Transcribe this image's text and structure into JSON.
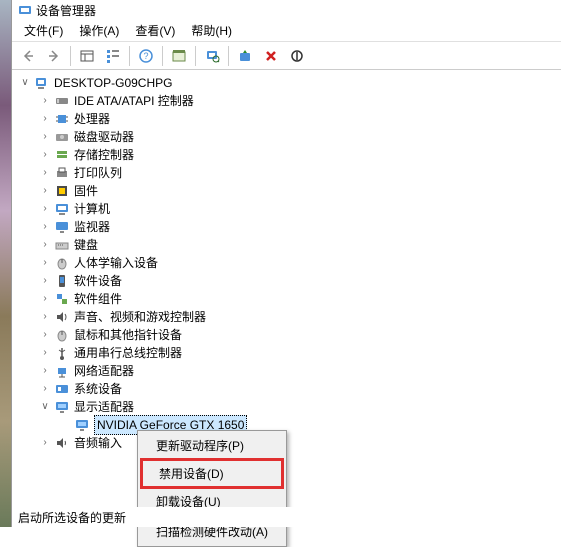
{
  "title": "设备管理器",
  "menu": {
    "file": "文件(F)",
    "action": "操作(A)",
    "view": "查看(V)",
    "help": "帮助(H)"
  },
  "root": "DESKTOP-G09CHPG",
  "categories": [
    {
      "label": "IDE ATA/ATAPI 控制器",
      "icon": "ide"
    },
    {
      "label": "处理器",
      "icon": "cpu"
    },
    {
      "label": "磁盘驱动器",
      "icon": "disk"
    },
    {
      "label": "存储控制器",
      "icon": "storage"
    },
    {
      "label": "打印队列",
      "icon": "printer"
    },
    {
      "label": "固件",
      "icon": "firmware"
    },
    {
      "label": "计算机",
      "icon": "computer"
    },
    {
      "label": "监视器",
      "icon": "monitor"
    },
    {
      "label": "键盘",
      "icon": "keyboard"
    },
    {
      "label": "人体学输入设备",
      "icon": "hid"
    },
    {
      "label": "软件设备",
      "icon": "software"
    },
    {
      "label": "软件组件",
      "icon": "component"
    },
    {
      "label": "声音、视频和游戏控制器",
      "icon": "sound"
    },
    {
      "label": "鼠标和其他指针设备",
      "icon": "mouse"
    },
    {
      "label": "通用串行总线控制器",
      "icon": "usb"
    },
    {
      "label": "网络适配器",
      "icon": "network"
    },
    {
      "label": "系统设备",
      "icon": "system"
    },
    {
      "label": "显示适配器",
      "icon": "display",
      "expanded": true,
      "children": [
        {
          "label": "NVIDIA GeForce GTX 1650",
          "selected": true
        }
      ]
    },
    {
      "label": "音频输入",
      "icon": "audio"
    }
  ],
  "context": {
    "update": "更新驱动程序(P)",
    "disable": "禁用设备(D)",
    "uninstall": "卸载设备(U)",
    "scan": "扫描检测硬件改动(A)"
  },
  "status": "启动所选设备的更新"
}
